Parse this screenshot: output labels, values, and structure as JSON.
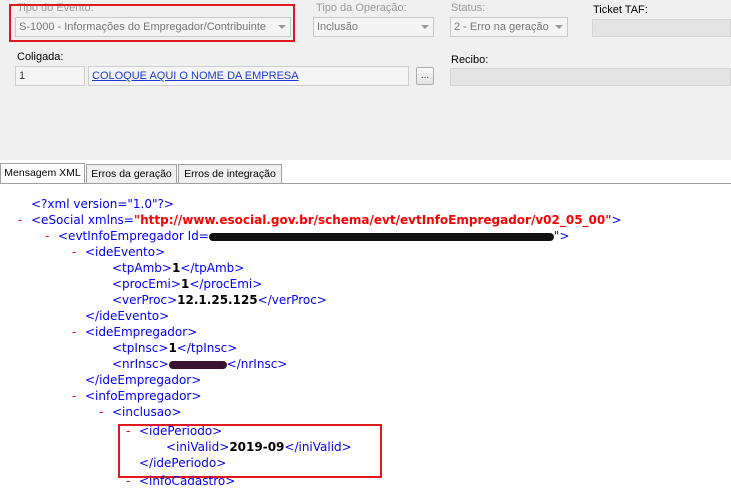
{
  "header": {
    "tipo_evento": {
      "label": "Tipo do Evento:",
      "value": "S-1000 - Informações do Empregador/Contribuinte"
    },
    "tipo_operacao": {
      "label": "Tipo da Operação:",
      "value": "Inclusão"
    },
    "status": {
      "label": "Status:",
      "value": "2 - Erro na geração"
    },
    "ticket": {
      "label": "Ticket TAF:",
      "value": ""
    },
    "coligada": {
      "label": "Coligada:",
      "code": "1",
      "name": "COLOQUE AQUI O NOME DA EMPRESA",
      "lookup_button": "..."
    },
    "recibo": {
      "label": "Recibo:",
      "value": ""
    }
  },
  "tabs": [
    {
      "label": "Mensagem XML",
      "active": true
    },
    {
      "label": "Erros da geração",
      "active": false
    },
    {
      "label": "Erros de integração",
      "active": false
    }
  ],
  "xml": {
    "declaration": "<?xml version=\"1.0\"?>",
    "esocial_open": "<eSocial xmlns=",
    "namespace": "\"http://www.esocial.gov.br/schema/evt/evtInfoEmpregador/v02_05_00\"",
    "esocial_close_bracket": ">",
    "evt_open": "<evtInfoEmpregador Id=",
    "evt_close_bracket": "\">",
    "ideEvento_open": "<ideEvento>",
    "tpAmb_open": "<tpAmb>",
    "tpAmb_value": "1",
    "tpAmb_close": "</tpAmb>",
    "procEmi_open": "<procEmi>",
    "procEmi_value": "1",
    "procEmi_close": "</procEmi>",
    "verProc_open": "<verProc>",
    "verProc_value": "12.1.25.125",
    "verProc_close": "</verProc>",
    "ideEvento_close": "</ideEvento>",
    "ideEmpregador_open": "<ideEmpregador>",
    "tpInsc_open": "<tpInsc>",
    "tpInsc_value": "1",
    "tpInsc_close": "</tpInsc>",
    "nrInsc_open": "<nrInsc>",
    "nrInsc_close": "</nrInsc>",
    "ideEmpregador_close": "</ideEmpregador>",
    "infoEmpregador_open": "<infoEmpregador>",
    "inclusao_open": "<inclusao>",
    "idePeriodo_open": "<idePeriodo>",
    "iniValid_open": "<iniValid>",
    "iniValid_value": "2019-09",
    "iniValid_close": "</iniValid>",
    "idePeriodo_close": "</idePeriodo>",
    "infoCadastro_open": "<infoCadastro>",
    "collapse_glyph": "-"
  },
  "colors": {
    "highlight": "#e0191d",
    "tag": "#0000ff",
    "attr_value": "#ff0000",
    "collapse": "#e00000"
  }
}
